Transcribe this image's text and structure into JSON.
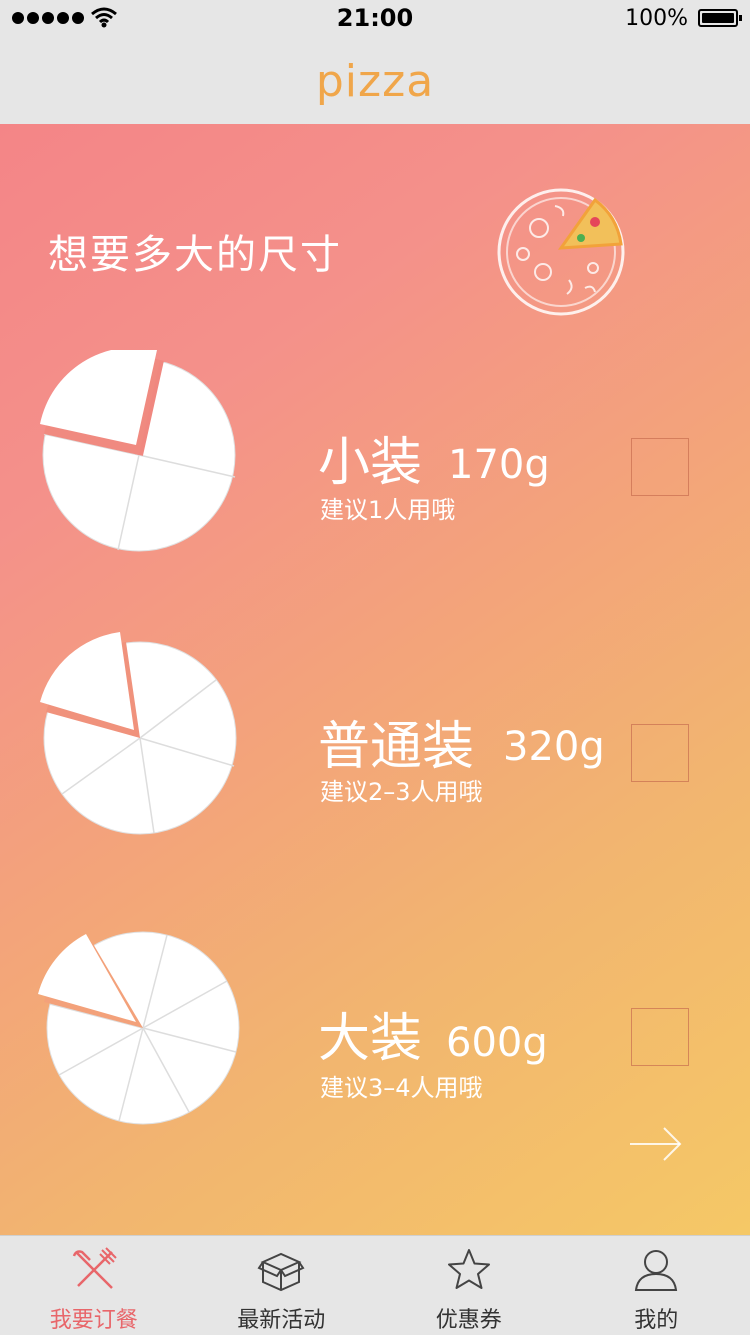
{
  "status_bar": {
    "time": "21:00",
    "battery": "100%"
  },
  "nav": {
    "title": "pizza"
  },
  "main": {
    "heading": "想要多大的尺寸",
    "sizes": [
      {
        "name": "小装",
        "weight": "170g",
        "hint": "建议1人用哦",
        "slices": 4,
        "checked": false
      },
      {
        "name": "普通装",
        "weight": "320g",
        "hint": "建议2–3人用哦",
        "slices": 6,
        "checked": false
      },
      {
        "name": "大装",
        "weight": "600g",
        "hint": "建议3–4人用哦",
        "slices": 8,
        "checked": false
      }
    ]
  },
  "tabs": [
    {
      "label": "我要订餐",
      "icon": "fork-knife-icon",
      "active": true
    },
    {
      "label": "最新活动",
      "icon": "box-icon",
      "active": false
    },
    {
      "label": "优惠券",
      "icon": "star-icon",
      "active": false
    },
    {
      "label": "我的",
      "icon": "user-icon",
      "active": false
    }
  ],
  "colors": {
    "accent": "#f0a64a",
    "active_tab": "#e8666a",
    "gradient_start": "#f48587",
    "gradient_end": "#f5c866"
  }
}
